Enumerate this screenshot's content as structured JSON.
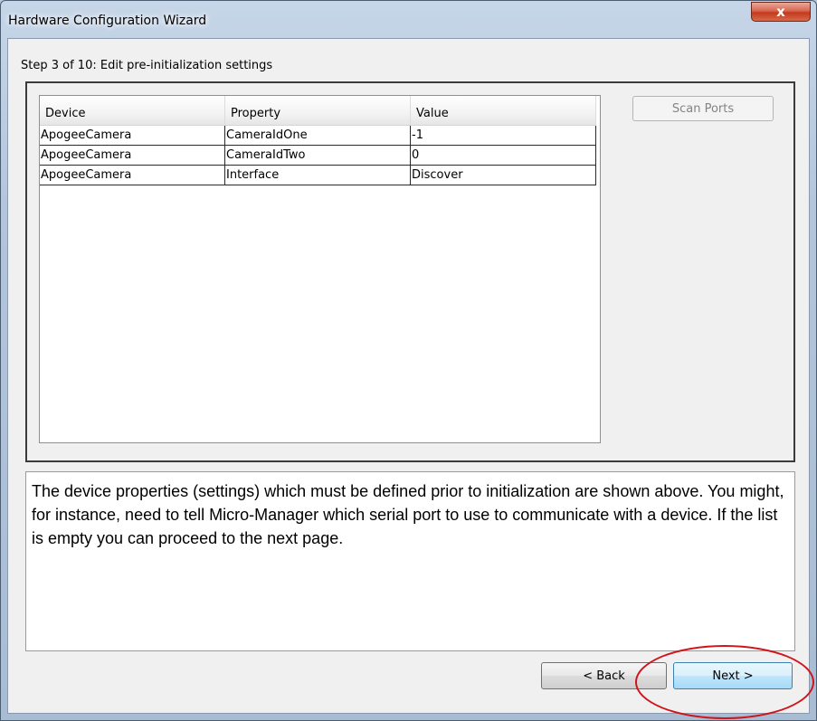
{
  "window": {
    "title": "Hardware Configuration Wizard",
    "close_glyph": "x"
  },
  "step": {
    "label": "Step 3 of 10: Edit pre-initialization settings"
  },
  "table": {
    "headers": [
      "Device",
      "Property",
      "Value"
    ],
    "rows": [
      [
        "ApogeeCamera",
        "CameraIdOne",
        "-1"
      ],
      [
        "ApogeeCamera",
        "CameraIdTwo",
        "0"
      ],
      [
        "ApogeeCamera",
        "Interface",
        "Discover"
      ]
    ]
  },
  "buttons": {
    "scan_ports": "Scan Ports",
    "back": "< Back",
    "next": "Next >"
  },
  "description": "The device properties (settings) which must be defined prior to initialization are shown above. You might, for instance, need to tell Micro-Manager which serial port to use to communicate with a device.  If the list is empty you can proceed to the next page.",
  "colors": {
    "highlight": "#d0141b",
    "next_button": "#bee6fd",
    "close_button": "#c4391f"
  }
}
